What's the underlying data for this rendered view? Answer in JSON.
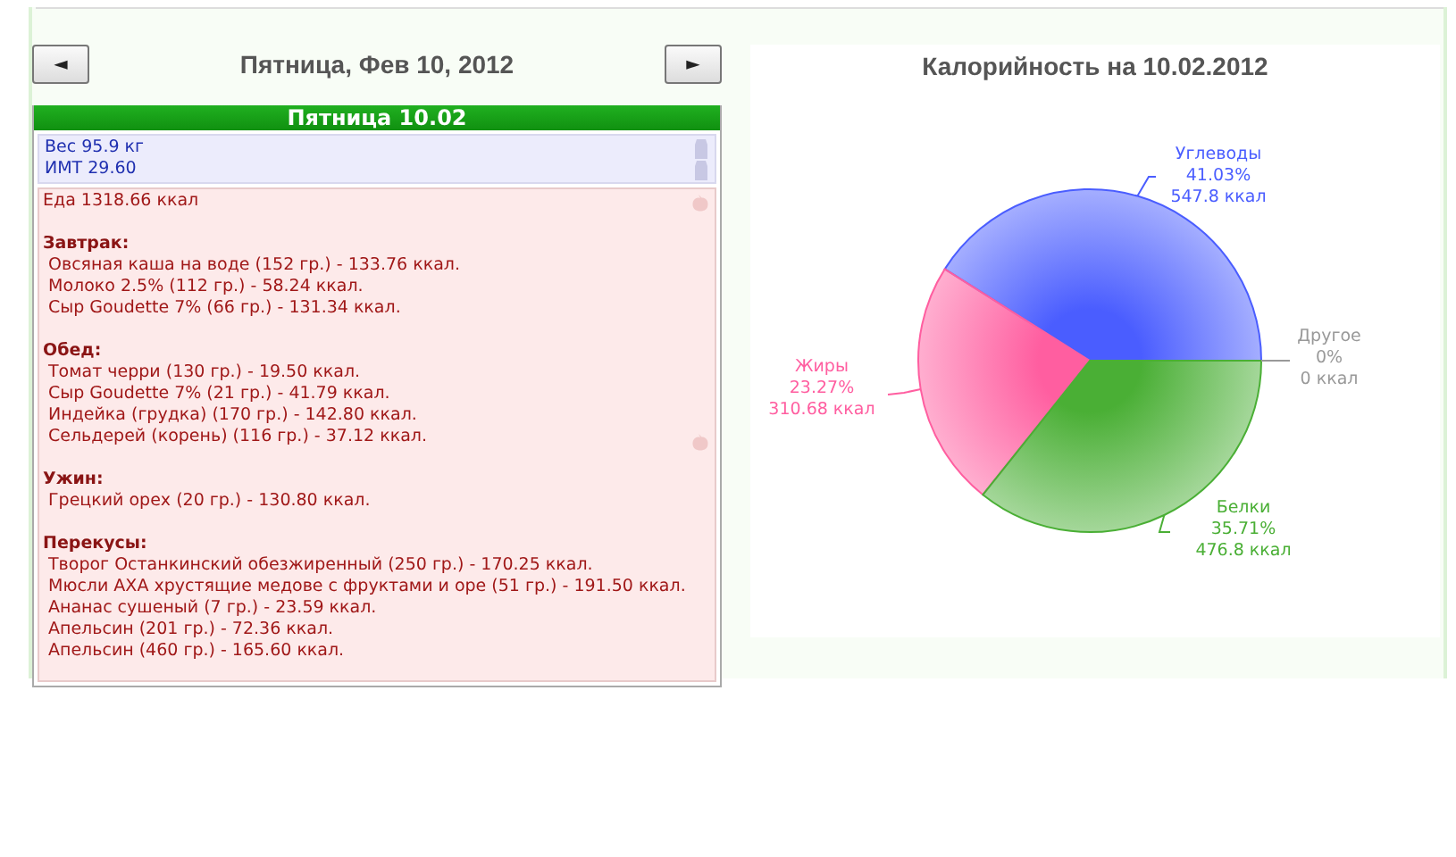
{
  "day_nav": {
    "prev": "◄",
    "title": "Пятница, Фев 10, 2012",
    "next": "►"
  },
  "day_panel": {
    "header": "Пятница 10.02",
    "measurements": [
      "Вес 95.9 кг",
      "ИМТ 29.60"
    ],
    "food_total": "Еда 1318.66 ккал",
    "meals": [
      {
        "title": "Завтрак:",
        "items": [
          "Овсяная каша на воде (152 гр.) - 133.76 ккал.",
          "Молоко 2.5% (112 гр.) - 58.24 ккал.",
          "Сыр Goudette 7% (66 гр.) - 131.34 ккал."
        ]
      },
      {
        "title": "Обед:",
        "items": [
          "Томат черри (130 гр.) - 19.50 ккал.",
          "Сыр Goudette 7% (21 гр.) - 41.79 ккал.",
          "Индейка (грудка) (170 гр.) - 142.80 ккал.",
          "Сельдерей (корень) (116 гр.) - 37.12 ккал."
        ]
      },
      {
        "title": "Ужин:",
        "items": [
          "Грецкий орех (20 гр.) - 130.80 ккал."
        ]
      },
      {
        "title": "Перекусы:",
        "items": [
          "Творог Останкинский обезжиренный (250 гр.) - 170.25 ккал.",
          "Мюсли АХА хрустящие медове с фруктами и ope (51 гр.) - 191.50 ккал.",
          "Ананас сушеный (7 гр.) - 23.59 ккал.",
          "Апельсин (201 гр.) - 72.36 ккал.",
          "Апельсин (460 гр.) - 165.60 ккал."
        ]
      }
    ]
  },
  "calorie_chart": {
    "title": "Калорийность на 10.02.2012",
    "chart_data": {
      "type": "pie",
      "categories": [
        "Углеводы",
        "Жиры",
        "Белки",
        "Другое"
      ],
      "values": [
        41.03,
        23.27,
        35.71,
        0
      ]
    },
    "slice_labels": [
      {
        "percent": "41.03%",
        "kcal": "547.8 ккал",
        "color": "#4a5dff"
      },
      {
        "percent": "23.27%",
        "kcal": "310.68 ккал",
        "color": "#ff5ea0"
      },
      {
        "percent": "35.71%",
        "kcal": "476.8 ккал",
        "color": "#4aaf35"
      },
      {
        "percent": "0%",
        "kcal": "0 ккал",
        "color": "#999999"
      }
    ]
  }
}
